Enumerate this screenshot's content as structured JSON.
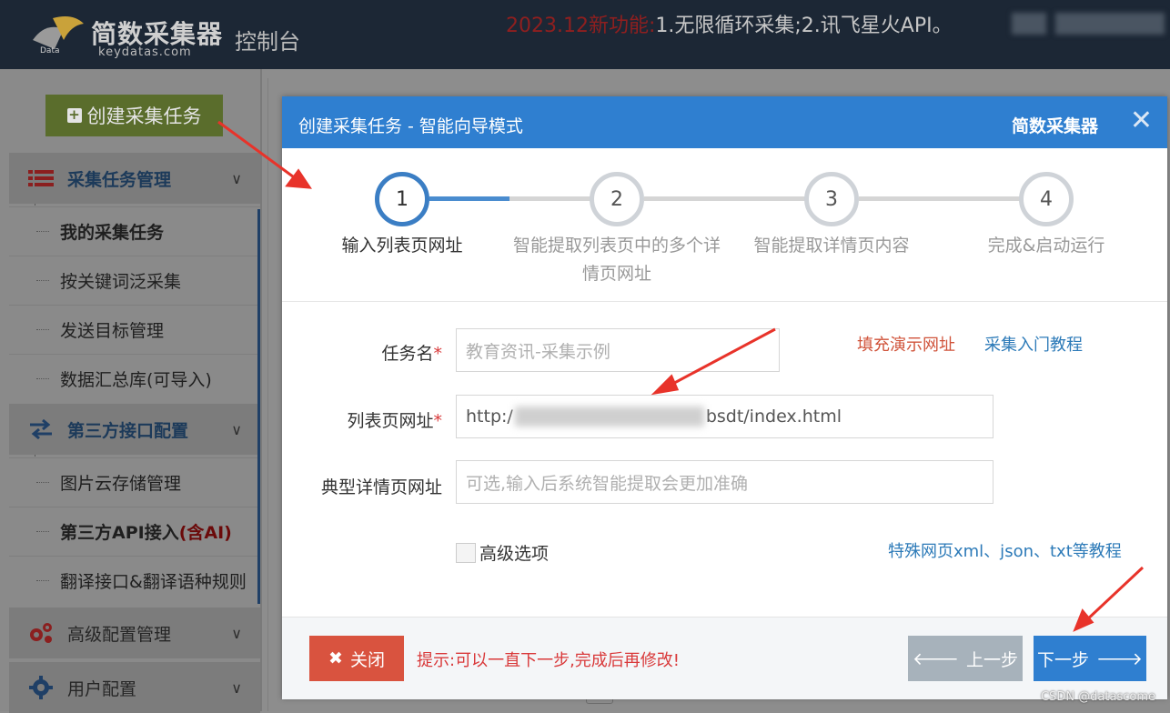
{
  "header": {
    "logo_title": "简数采集器",
    "logo_sub": "keydatas.com",
    "console_label": "控制台",
    "announcement_new": "2023.12新功能:",
    "announcement_body": "1.无限循环采集;2.讯飞星火API。"
  },
  "sidebar": {
    "create_button": "创建采集任务",
    "groups": [
      {
        "label": "采集任务管理",
        "icon": "list-icon"
      },
      {
        "label": "第三方接口配置",
        "icon": "swap-arrows-icon"
      },
      {
        "label": "高级配置管理",
        "icon": "gears-icon"
      },
      {
        "label": "用户配置",
        "icon": "gear-icon"
      }
    ],
    "items": [
      {
        "label": "我的采集任务"
      },
      {
        "label": "按关键词泛采集"
      },
      {
        "label": "发送目标管理"
      },
      {
        "label": "数据汇总库(可导入)"
      },
      {
        "label": "图片云存储管理"
      },
      {
        "label": "第三方API接入",
        "suffix": "(含AI)"
      },
      {
        "label": "翻译接口&翻译语种规则"
      }
    ]
  },
  "modal": {
    "title": "创建采集任务 - 智能向导模式",
    "brand": "简数采集器",
    "close_glyph": "✕",
    "steps": [
      {
        "num": "1",
        "label": "输入列表页网址"
      },
      {
        "num": "2",
        "label": "智能提取列表页中的多个详情页网址"
      },
      {
        "num": "3",
        "label": "智能提取详情页内容"
      },
      {
        "num": "4",
        "label": "完成&启动运行"
      }
    ],
    "current_step": 1,
    "form": {
      "task_name_label": "任务名",
      "task_name_placeholder": "教育资讯-采集示例",
      "list_url_label": "列表页网址",
      "list_url_prefix": "http:/",
      "list_url_suffix": "bsdt/index.html",
      "detail_url_label": "典型详情页网址",
      "detail_url_placeholder": "可选,输入后系统智能提取会更加准确",
      "required_mark": "*",
      "fill_demo_link": "填充演示网址",
      "tutorial_link": "采集入门教程",
      "advanced_label": "高级选项",
      "special_link": "特殊网页xml、json、txt等教程"
    },
    "footer": {
      "close_label": "关闭",
      "hint": "提示:可以一直下一步,完成后再修改!",
      "prev_label": "上一步",
      "next_label": "下一步"
    }
  },
  "watermark": "CSDN @datascome",
  "colors": {
    "primary": "#2f7fd0",
    "danger": "#d9533f",
    "create_green": "#5a6d2c",
    "topbar": "#1c2735"
  }
}
